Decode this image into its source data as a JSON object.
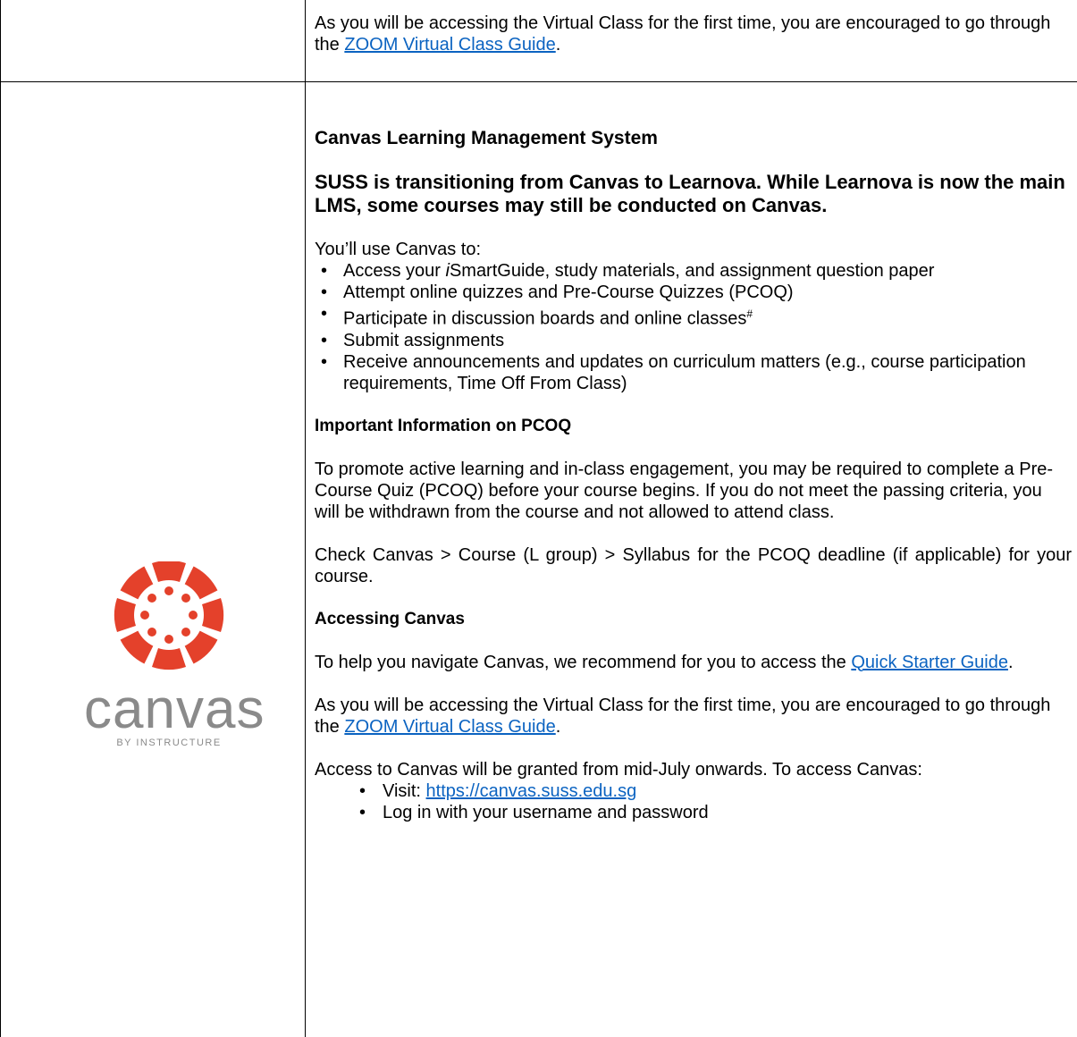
{
  "top_row": {
    "zoom_text_before": "As you will be accessing the Virtual Class for the first time, you are encouraged to go through the ",
    "zoom_link": "ZOOM Virtual Class Guide",
    "zoom_text_after": "."
  },
  "logo": {
    "word": "canvas",
    "tagline": "BY INSTRUCTURE",
    "brand_color": "#e4412b",
    "word_color": "#8a8a8a"
  },
  "canvas_section": {
    "title": "Canvas Learning Management System",
    "notice": "SUSS is transitioning from Canvas to Learnova. While Learnova is now the main LMS, some courses may still be conducted on Canvas.",
    "uses_intro": "You’ll use Canvas to:",
    "uses": {
      "item1_before": "Access your ",
      "item1_italic": "i",
      "item1_after": "SmartGuide, study materials, and assignment question paper",
      "item2": "Attempt online quizzes and Pre-Course Quizzes (PCOQ)",
      "item3": "Participate in discussion boards and online classes",
      "item3_sup": "#",
      "item4": "Submit assignments",
      "item5": "Receive announcements and updates on curriculum matters (e.g., course participation requirements, Time Off From Class)"
    },
    "pcoq_heading": "Important Information on PCOQ",
    "pcoq_text": "To promote active learning and in-class engagement, you may be required to complete a Pre-Course Quiz (PCOQ) before your course begins. If you do not meet the passing criteria, you will be withdrawn from the course and not allowed to attend class.",
    "syllabus_text": "Check Canvas > Course (L group) > Syllabus for the PCOQ deadline (if applicable) for your course.",
    "access_heading": "Accessing Canvas",
    "navigate_before": "To help you navigate Canvas, we recommend for you to access the ",
    "navigate_link": "Quick Starter Guide",
    "navigate_after": ".",
    "zoom_text_before": "As you will be accessing the Virtual Class for the first time, you are encouraged to go through the ",
    "zoom_link": "ZOOM Virtual Class Guide",
    "zoom_text_after": ".",
    "access_intro": "Access to Canvas will be granted from mid-July onwards. To access Canvas:",
    "visit_label": "Visit: ",
    "visit_link": "https://canvas.suss.edu.sg",
    "login_text": "Log in with your username and password"
  },
  "colors": {
    "link": "#0b63c1",
    "border": "#000000"
  }
}
